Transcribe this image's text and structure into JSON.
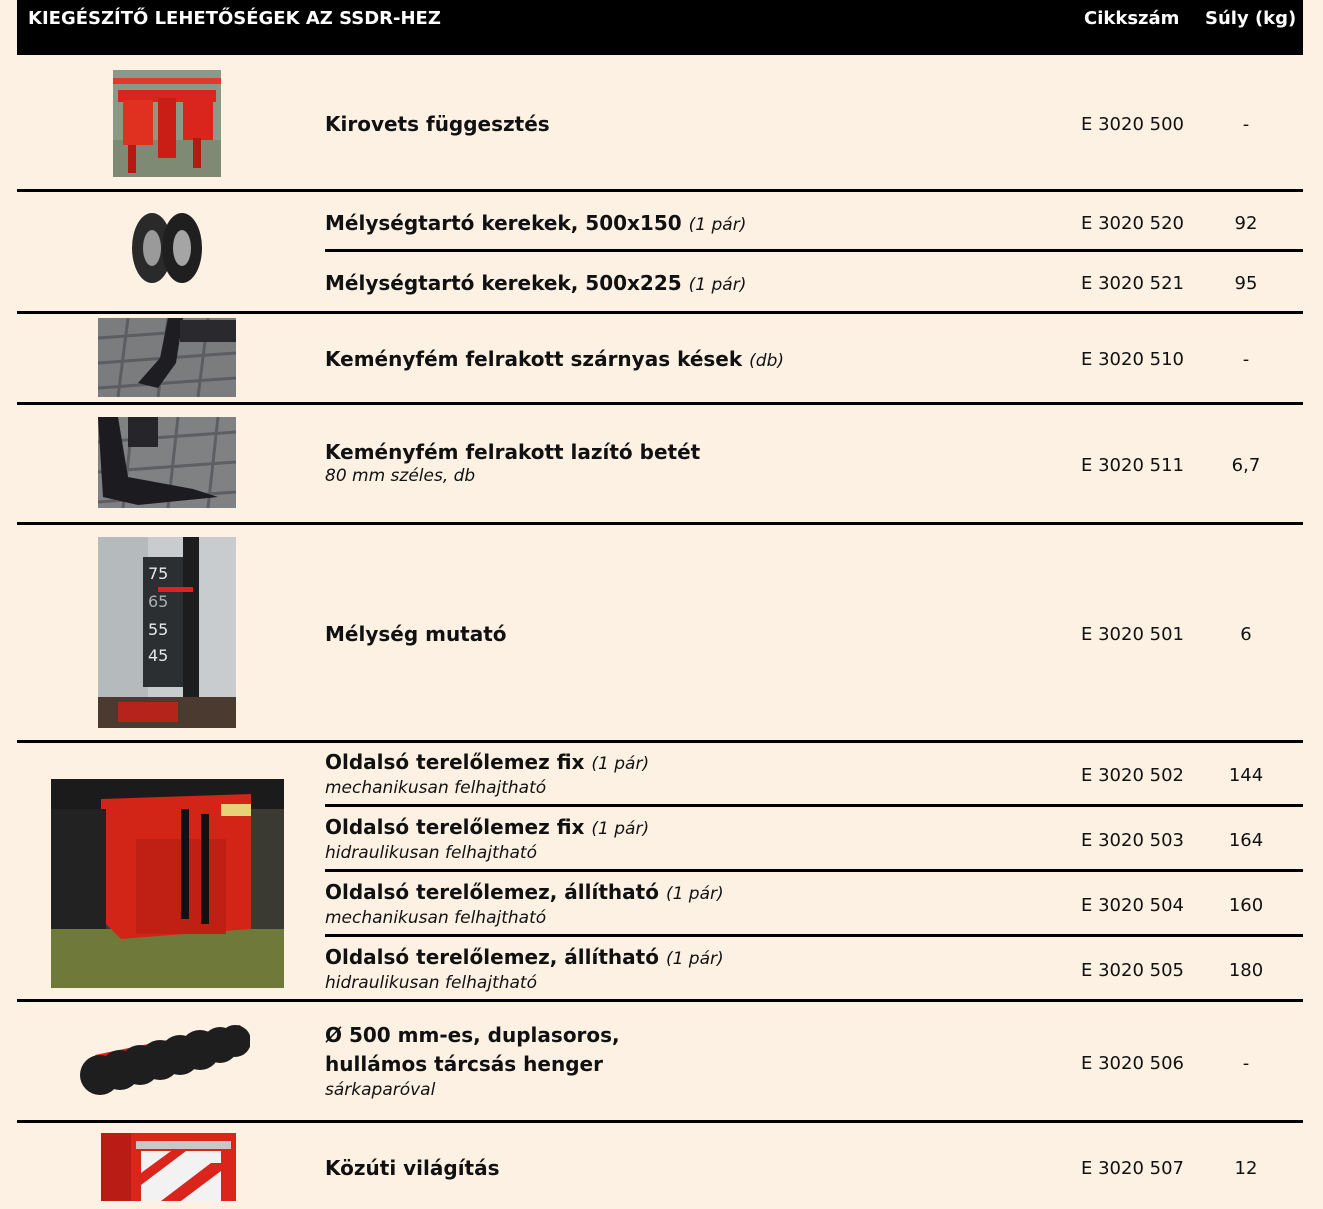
{
  "header": {
    "title": "KIEGÉSZÍTŐ LEHETŐSÉGEK AZ SSDR-HEZ",
    "col_code": "Cikkszám",
    "col_weight": "Súly (kg)"
  },
  "rows": [
    {
      "name": "Kirovets függesztés",
      "note": "",
      "sub": "",
      "code": "E 3020 500",
      "weight": "-"
    },
    {
      "name": "Mélységtartó kerekek, 500x150",
      "note": "(1 pár)",
      "sub": "",
      "code": "E 3020 520",
      "weight": "92"
    },
    {
      "name": "Mélységtartó kerekek, 500x225",
      "note": "(1 pár)",
      "sub": "",
      "code": "E 3020 521",
      "weight": "95"
    },
    {
      "name": "Keményfém felrakott szárnyas kések",
      "note": "(db)",
      "sub": "",
      "code": "E 3020 510",
      "weight": "-"
    },
    {
      "name": "Keményfém felrakott lazító betét",
      "note": "",
      "sub": "80 mm széles, db",
      "code": "E 3020 511",
      "weight": "6,7"
    },
    {
      "name": "Mélység mutató",
      "note": "",
      "sub": "",
      "code": "E 3020 501",
      "weight": "6"
    },
    {
      "name": "Oldalsó terelőlemez fix",
      "note": "(1 pár)",
      "sub": "mechanikusan felhajtható",
      "code": "E 3020 502",
      "weight": "144"
    },
    {
      "name": "Oldalsó terelőlemez fix",
      "note": "(1 pár)",
      "sub": "hidraulikusan felhajtható",
      "code": "E 3020 503",
      "weight": "164"
    },
    {
      "name": "Oldalsó terelőlemez, állítható",
      "note": "(1 pár)",
      "sub": "mechanikusan felhajtható",
      "code": "E 3020 504",
      "weight": "160"
    },
    {
      "name": "Oldalsó terelőlemez, állítható",
      "note": "(1 pár)",
      "sub": "hidraulikusan felhajtható",
      "code": "E 3020 505",
      "weight": "180"
    },
    {
      "name": "Ø 500 mm-es, duplasoros,",
      "name2": "hullámos tárcsás henger",
      "note": "",
      "sub": "sárkaparóval",
      "code": "E 3020 506",
      "weight": "-"
    },
    {
      "name": "Közúti világítás",
      "note": "",
      "sub": "",
      "code": "E 3020 507",
      "weight": "12"
    }
  ],
  "depth_gauge_marks": [
    "75",
    "65",
    "55",
    "45"
  ],
  "colors": {
    "background": "#fdf1e4",
    "header": "#000000",
    "accent_red": "#d9251c"
  }
}
